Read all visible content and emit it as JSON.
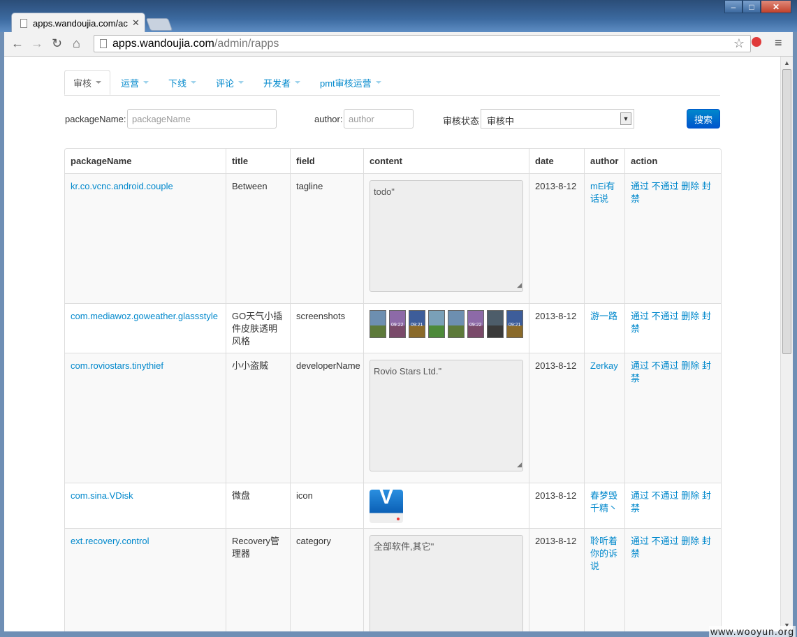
{
  "browser": {
    "tab_title": "apps.wandoujia.com/ac",
    "url_host": "apps.wandoujia.com",
    "url_path": "/admin/rapps"
  },
  "nav_tabs": [
    {
      "label": "审核",
      "active": true
    },
    {
      "label": "运营"
    },
    {
      "label": "下线"
    },
    {
      "label": "评论"
    },
    {
      "label": "开发者"
    },
    {
      "label": "pmt审核运营"
    }
  ],
  "filters": {
    "package_label": "packageName:",
    "package_placeholder": "packageName",
    "author_label": "author:",
    "author_placeholder": "author",
    "status_label": "审核状态",
    "status_value": "审核中",
    "search_button": "搜索"
  },
  "table": {
    "headers": [
      "packageName",
      "title",
      "field",
      "content",
      "date",
      "author",
      "action"
    ],
    "rows": [
      {
        "package": "kr.co.vcnc.android.couple",
        "title": "Between",
        "field": "tagline",
        "content": "todo\"",
        "date": "2013-8-12",
        "author": "mEi有话说",
        "actions": "通过 不通过 删除 封禁"
      },
      {
        "package": "com.mediawoz.goweather.glassstyle",
        "title": "GO天气小插件皮肤透明风格",
        "field": "screenshots",
        "date": "2013-8-12",
        "author": "游一路",
        "actions": "通过 不通过 删除 封禁"
      },
      {
        "package": "com.roviostars.tinythief",
        "title": "小小盗贼",
        "field": "developerName",
        "content": "Rovio Stars Ltd.\"",
        "date": "2013-8-12",
        "author": "Zerkay",
        "actions": "通过 不通过 删除 封禁"
      },
      {
        "package": "com.sina.VDisk",
        "title": "微盘",
        "field": "icon",
        "icon_letter": "V",
        "date": "2013-8-12",
        "author": "春梦毁千精丶",
        "actions": "通过 不通过 删除 封禁"
      },
      {
        "package": "ext.recovery.control",
        "title": "Recovery管理器",
        "field": "category",
        "content": "全部软件,其它\"",
        "date": "2013-8-12",
        "author": "聆听着你的诉说",
        "actions": "通过 不通过 删除 封禁"
      }
    ]
  },
  "screenshot_thumbs": [
    {
      "sky": "#6d8fb0",
      "ground": "#5d7a3a",
      "time": ""
    },
    {
      "sky": "#8d6aa8",
      "ground": "#7a4a6a",
      "time": "09:22"
    },
    {
      "sky": "#3d5d9a",
      "ground": "#8a6a2a",
      "time": "09:21"
    },
    {
      "sky": "#7aa0b8",
      "ground": "#4d8a3a",
      "time": ""
    },
    {
      "sky": "#6d8fb0",
      "ground": "#5d7a3a",
      "time": ""
    },
    {
      "sky": "#8d6aa8",
      "ground": "#7a4a6a",
      "time": "09:22"
    },
    {
      "sky": "#4d5d6a",
      "ground": "#3a3a3a",
      "time": ""
    },
    {
      "sky": "#3d5d9a",
      "ground": "#8a6a2a",
      "time": "09:21"
    }
  ],
  "watermark": "www.wooyun.org",
  "colors": {
    "link": "#0088cc",
    "primary_button": "#0066cc"
  }
}
